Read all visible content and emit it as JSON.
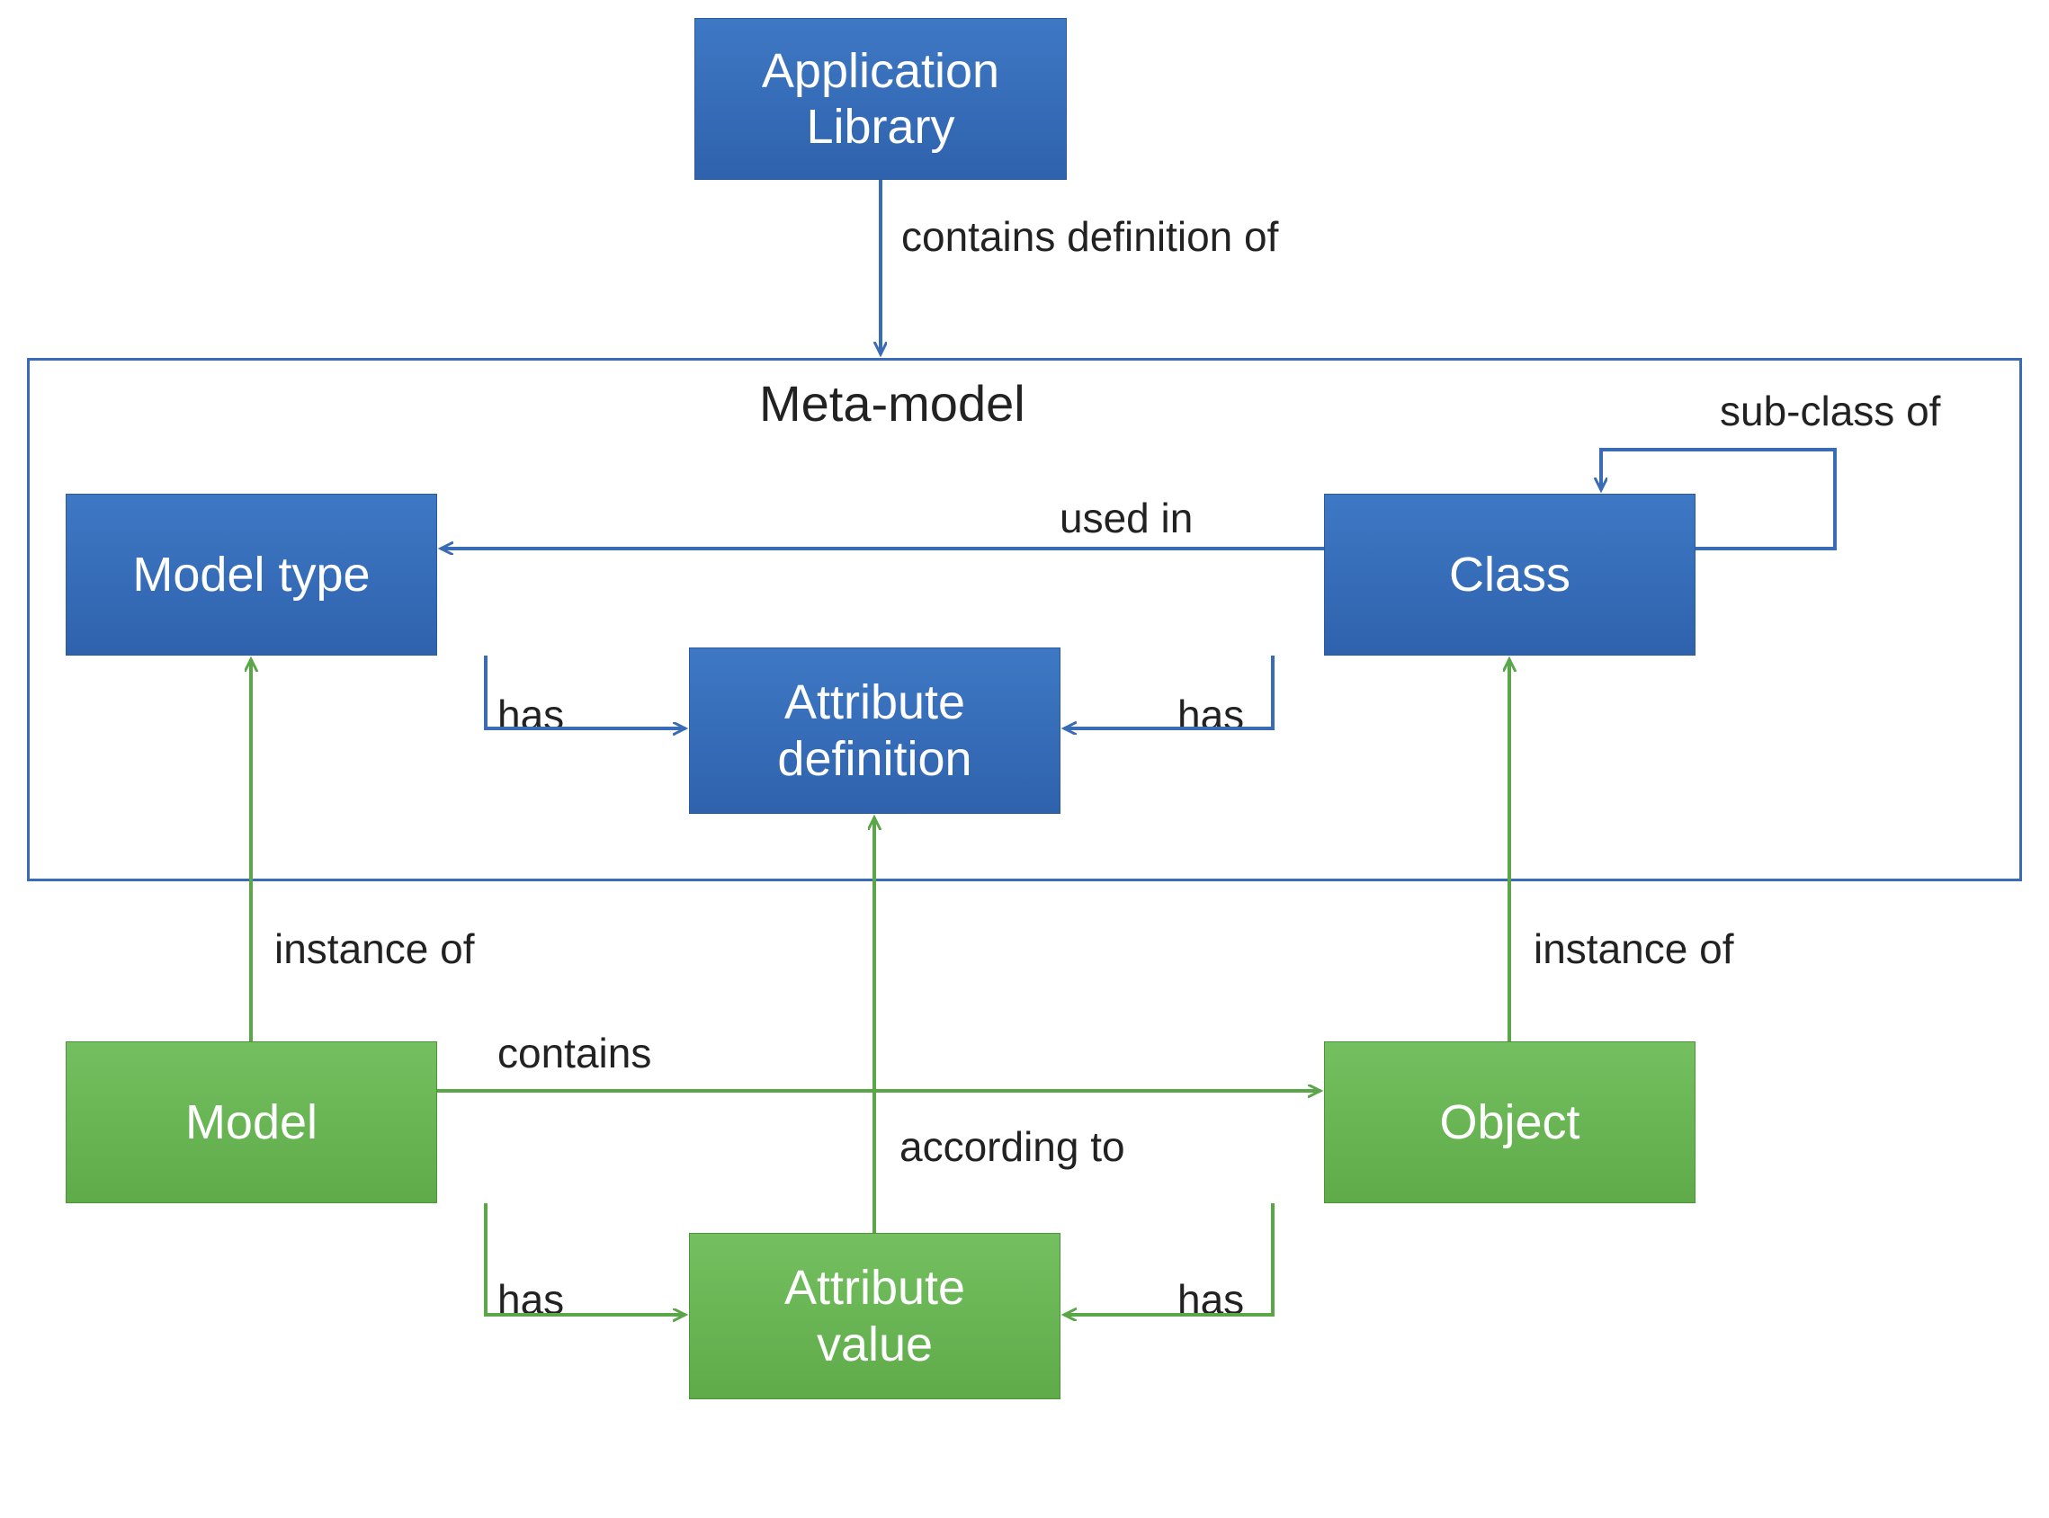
{
  "diagram": {
    "nodes": {
      "app_library": {
        "line1": "Application",
        "line2": "Library",
        "color": "blue"
      },
      "meta_model_title": "Meta-model",
      "model_type": {
        "text": "Model type",
        "color": "blue"
      },
      "class": {
        "text": "Class",
        "color": "blue"
      },
      "attr_def": {
        "line1": "Attribute",
        "line2": "definition",
        "color": "blue"
      },
      "model": {
        "text": "Model",
        "color": "green"
      },
      "object": {
        "text": "Object",
        "color": "green"
      },
      "attr_value": {
        "line1": "Attribute",
        "line2": "value",
        "color": "green"
      }
    },
    "edges": {
      "app_to_meta": "contains definition of",
      "class_to_modeltype": "used in",
      "class_self": "sub-class of",
      "modeltype_to_attrdef": "has",
      "class_to_attrdef": "has",
      "model_to_modeltype": "instance of",
      "object_to_class": "instance of",
      "model_to_object": "contains",
      "model_to_attrvalue": "has",
      "object_to_attrvalue": "has",
      "attrvalue_to_attrdef": "according to"
    },
    "colors": {
      "blue_stroke": "#3a6bb7",
      "green_stroke": "#5aa648"
    }
  }
}
